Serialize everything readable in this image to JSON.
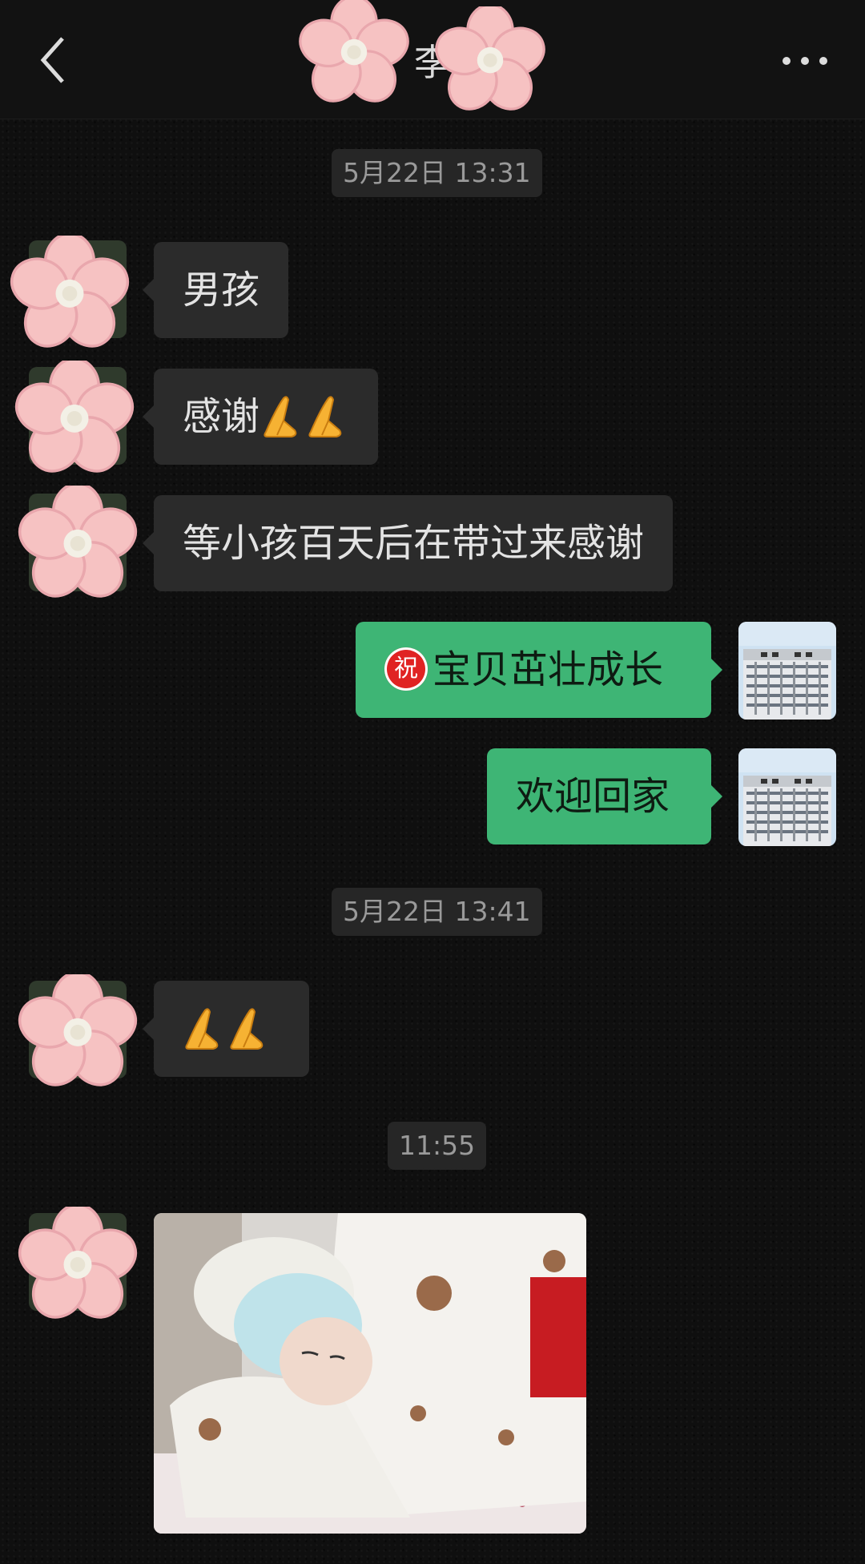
{
  "header": {
    "title": "李",
    "back_icon": "chevron-left-icon",
    "more_icon": "more-horizontal-icon"
  },
  "colors": {
    "background": "#0f0f0f",
    "incoming_bubble": "#2b2b2b",
    "outgoing_bubble": "#3eb575",
    "timestamp_bg": "#262626"
  },
  "messages": {
    "ts1": "5月22日 13:31",
    "m1": "男孩",
    "m2": "感谢",
    "m3": "等小孩百天后在带过来感谢",
    "m4_badge": "祝",
    "m4": "宝贝茁壮成长",
    "m5": "欢迎回家",
    "ts2": "5月22日 13:41",
    "ts3": "11:55"
  },
  "icons": {
    "pray": "folded-hands-icon",
    "blessing": "blessing-badge-icon",
    "avatar_sticker": "flower-icon",
    "self_avatar": "hospital-building-icon"
  }
}
